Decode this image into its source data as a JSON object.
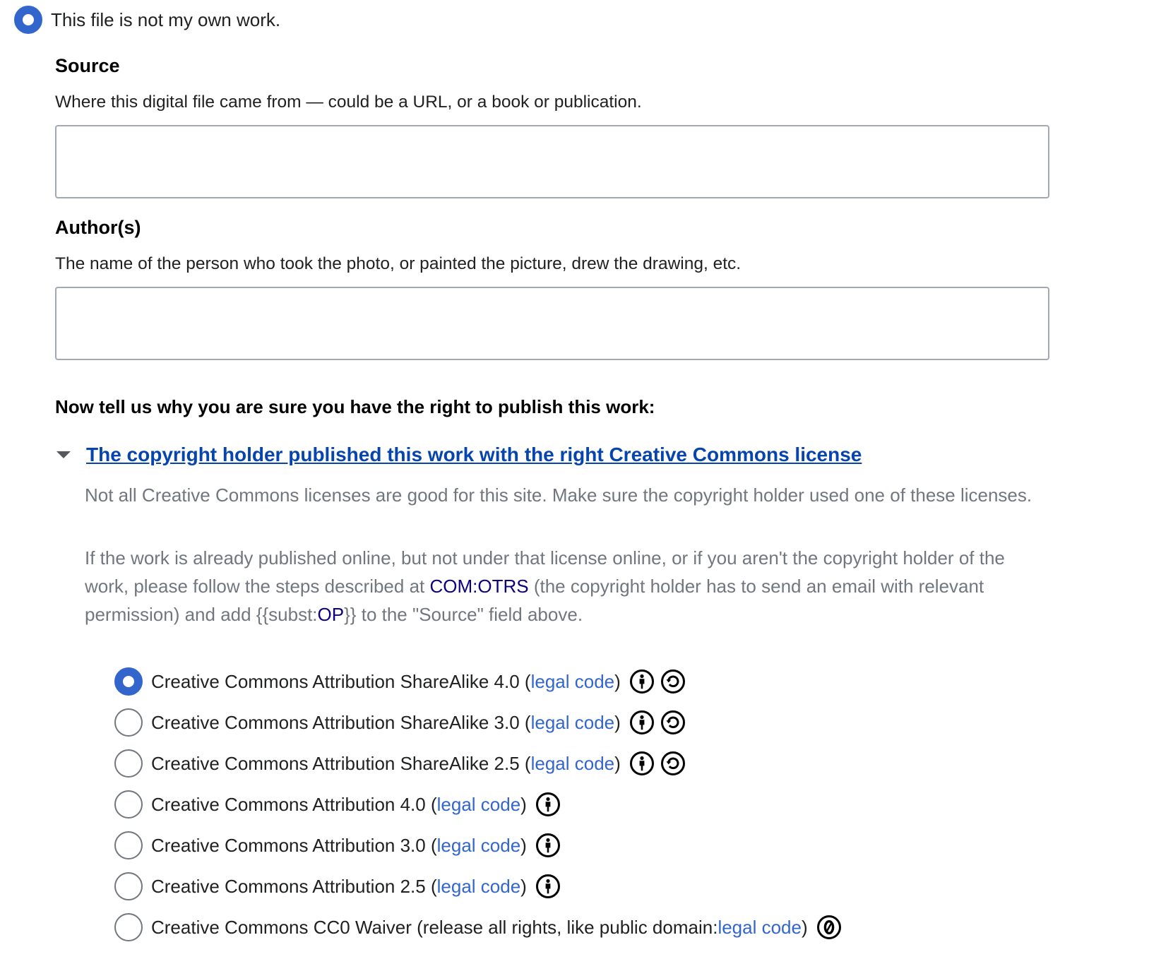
{
  "own_work": {
    "label": "This file is not my own work.",
    "checked": true
  },
  "source": {
    "title": "Source",
    "help": "Where this digital file came from — could be a URL, or a book or publication.",
    "value": ""
  },
  "author": {
    "title": "Author(s)",
    "help": "The name of the person who took the photo, or painted the picture, drew the drawing, etc.",
    "value": ""
  },
  "why_heading": "Now tell us why you are sure you have the right to publish this work:",
  "cc_toggle": {
    "label": "The copyright holder published this work with the right Creative Commons license",
    "expanded": true
  },
  "explain": {
    "para1": "Not all Creative Commons licenses are good for this site. Make sure the copyright holder used one of these licenses.",
    "para2_a": "If the work is already published online, but not under that license online, or if you aren't the copyright holder of the work, please follow the steps described at ",
    "otrs_link": "COM:OTRS",
    "para2_b": " (the copyright holder has to send an email with relevant permission) and add {{subst:",
    "op_link": "OP",
    "para2_c": "}} to the \"Source\" field above."
  },
  "legal_code_label": "legal code",
  "licenses": [
    {
      "prefix": "Creative Commons Attribution ShareAlike 4.0 (",
      "suffix": ")",
      "icons": [
        "cc-by-icon",
        "cc-sa-icon"
      ],
      "checked": true
    },
    {
      "prefix": "Creative Commons Attribution ShareAlike 3.0 (",
      "suffix": ")",
      "icons": [
        "cc-by-icon",
        "cc-sa-icon"
      ],
      "checked": false
    },
    {
      "prefix": "Creative Commons Attribution ShareAlike 2.5 (",
      "suffix": ")",
      "icons": [
        "cc-by-icon",
        "cc-sa-icon"
      ],
      "checked": false
    },
    {
      "prefix": "Creative Commons Attribution 4.0 (",
      "suffix": ")",
      "icons": [
        "cc-by-icon"
      ],
      "checked": false
    },
    {
      "prefix": "Creative Commons Attribution 3.0 (",
      "suffix": ")",
      "icons": [
        "cc-by-icon"
      ],
      "checked": false
    },
    {
      "prefix": "Creative Commons Attribution 2.5 (",
      "suffix": ")",
      "icons": [
        "cc-by-icon"
      ],
      "checked": false
    },
    {
      "prefix": "Creative Commons CC0 Waiver (release all rights, like public domain: ",
      "suffix": ")",
      "icons": [
        "cc-zero-icon"
      ],
      "checked": false
    }
  ],
  "colors": {
    "accent": "#3366cc",
    "link": "#0645ad",
    "muted_text": "#72777d",
    "otrs_link": "#0b0080"
  }
}
